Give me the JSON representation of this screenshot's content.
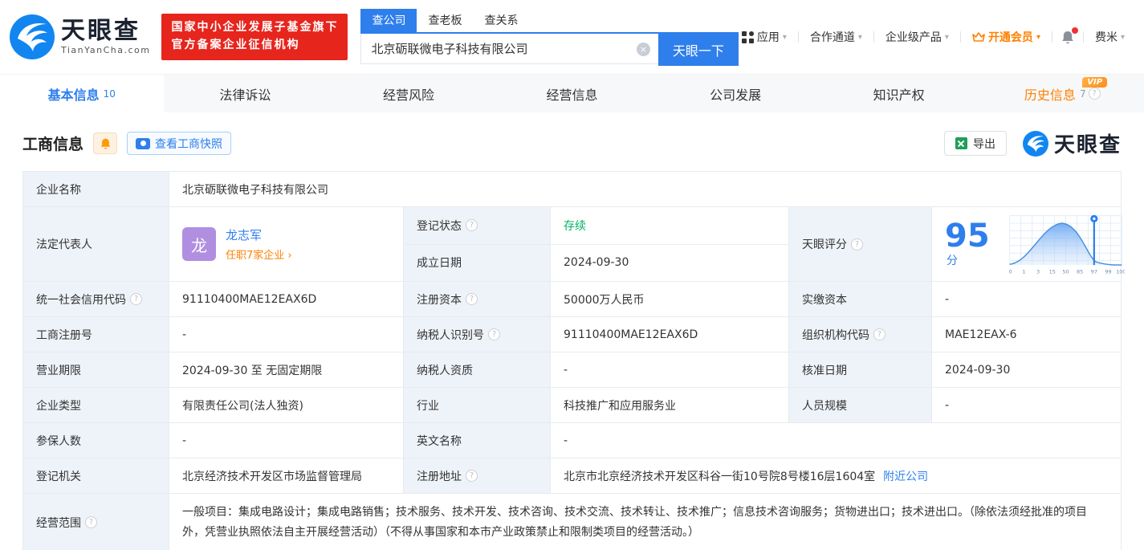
{
  "colors": {
    "accent": "#2e7fec",
    "orange": "#ff8000",
    "green": "#00b365",
    "badge_red": "#e6251d",
    "avatar_purple": "#b08fe1"
  },
  "icons": {
    "caret_down": "▾",
    "arrow_right": "›",
    "qmark": "?",
    "close": "×"
  },
  "brand": {
    "name": "天眼查",
    "domain": "TianYanCha.com",
    "badge_line1": "国家中小企业发展子基金旗下",
    "badge_line2": "官方备案企业征信机构"
  },
  "search": {
    "tabs": [
      {
        "label": "查公司"
      },
      {
        "label": "查老板"
      },
      {
        "label": "查关系"
      }
    ],
    "input_value": "北京砺联微电子科技有限公司",
    "button_label": "天眼一下"
  },
  "nav": {
    "apps": "应用",
    "cooperation": "合作通道",
    "enterprise": "企业级产品",
    "vip": "开通会员",
    "user": "费米"
  },
  "tabs": [
    {
      "label": "基本信息",
      "count": "10"
    },
    {
      "label": "法律诉讼"
    },
    {
      "label": "经营风险"
    },
    {
      "label": "经营信息"
    },
    {
      "label": "公司发展"
    },
    {
      "label": "知识产权"
    },
    {
      "label": "历史信息",
      "count": "7",
      "vip_badge": "VIP"
    }
  ],
  "section": {
    "title": "工商信息",
    "snapshot_button": "查看工商快照",
    "export_button": "导出"
  },
  "company": {
    "name_label": "企业名称",
    "name": "北京砺联微电子科技有限公司"
  },
  "legal": {
    "label": "法定代表人",
    "avatar_text": "龙",
    "name": "龙志军",
    "positions_link": "任职7家企业"
  },
  "score": {
    "label": "天眼评分",
    "value": "95",
    "unit": "分",
    "ticks": [
      "0",
      "1",
      "3",
      "15",
      "50",
      "85",
      "97",
      "99",
      "100"
    ]
  },
  "fields": {
    "reg_status": {
      "label": "登记状态",
      "value": "存续"
    },
    "est_date": {
      "label": "成立日期",
      "value": "2024-09-30"
    },
    "credit_code": {
      "label": "统一社会信用代码",
      "value": "91110400MAE12EAX6D"
    },
    "reg_capital": {
      "label": "注册资本",
      "value": "50000万人民币"
    },
    "paid_capital": {
      "label": "实缴资本",
      "value": "-"
    },
    "reg_number": {
      "label": "工商注册号",
      "value": "-"
    },
    "taxpayer_id": {
      "label": "纳税人识别号",
      "value": "91110400MAE12EAX6D"
    },
    "org_code": {
      "label": "组织机构代码",
      "value": "MAE12EAX-6"
    },
    "business_term": {
      "label": "营业期限",
      "value": "2024-09-30 至 无固定期限"
    },
    "taxpayer_quality": {
      "label": "纳税人资质",
      "value": "-"
    },
    "approval_date": {
      "label": "核准日期",
      "value": "2024-09-30"
    },
    "company_type": {
      "label": "企业类型",
      "value": "有限责任公司(法人独资)"
    },
    "industry": {
      "label": "行业",
      "value": "科技推广和应用服务业"
    },
    "staff_size": {
      "label": "人员规模",
      "value": "-"
    },
    "insured_count": {
      "label": "参保人数",
      "value": "-"
    },
    "english_name": {
      "label": "英文名称",
      "value": "-"
    },
    "reg_authority": {
      "label": "登记机关",
      "value": "北京经济技术开发区市场监督管理局"
    },
    "reg_address": {
      "label": "注册地址",
      "value": "北京市北京经济技术开发区科谷一街10号院8号楼16层1604室",
      "link": "附近公司"
    },
    "business_scope": {
      "label": "经营范围",
      "value": "一般项目：集成电路设计；集成电路销售；技术服务、技术开发、技术咨询、技术交流、技术转让、技术推广；信息技术咨询服务；货物进出口；技术进出口。（除依法须经批准的项目外，凭营业执照依法自主开展经营活动）（不得从事国家和本市产业政策禁止和限制类项目的经营活动。）"
    }
  }
}
